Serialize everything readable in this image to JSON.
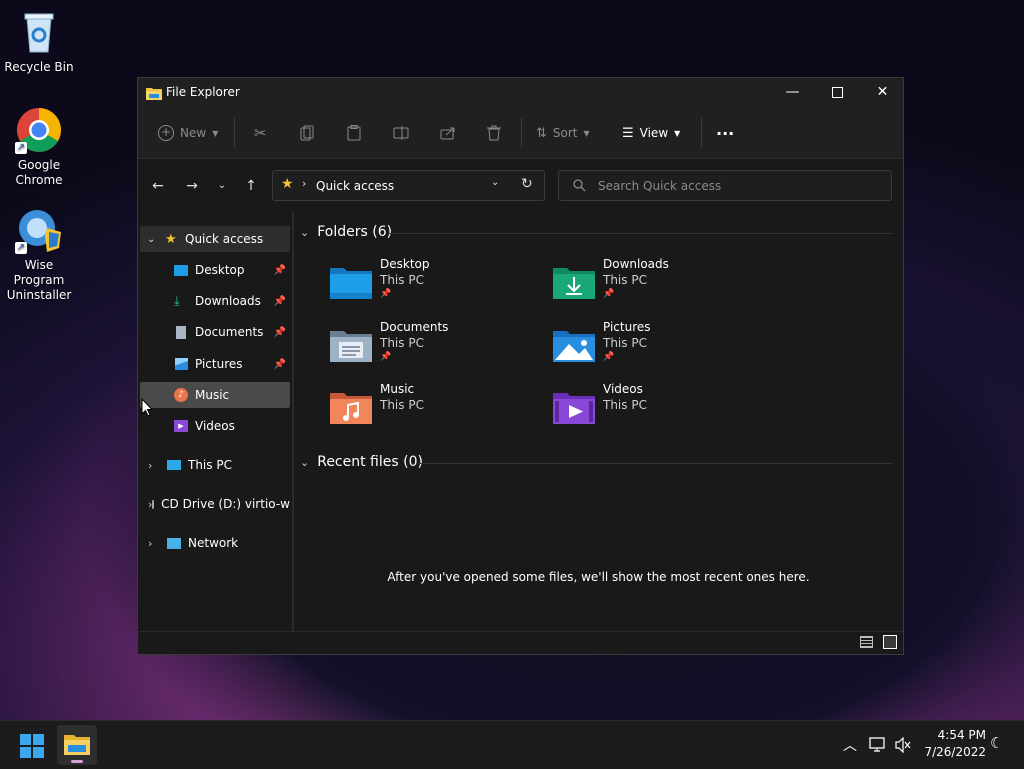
{
  "desktop": {
    "icons": [
      {
        "label": "Recycle Bin"
      },
      {
        "label": "Google\nChrome",
        "line1": "Google",
        "line2": "Chrome"
      },
      {
        "label": "Wise Program Uninstaller",
        "line1": "Wise Program",
        "line2": "Uninstaller"
      }
    ]
  },
  "window": {
    "title": "File Explorer",
    "toolbar": {
      "new_label": "New",
      "sort_label": "Sort",
      "view_label": "View",
      "more_label": "···"
    },
    "address": {
      "path": "Quick access"
    },
    "search": {
      "placeholder": "Search Quick access"
    },
    "sidebar": {
      "quick_access": "Quick access",
      "items": [
        {
          "label": "Desktop",
          "pinned": true
        },
        {
          "label": "Downloads",
          "pinned": true
        },
        {
          "label": "Documents",
          "pinned": true
        },
        {
          "label": "Pictures",
          "pinned": true
        },
        {
          "label": "Music",
          "pinned": false
        },
        {
          "label": "Videos",
          "pinned": false
        }
      ],
      "this_pc": "This PC",
      "cd_drive": "CD Drive (D:) virtio-w",
      "network": "Network"
    },
    "folders_header": "Folders (6)",
    "folders": [
      {
        "name": "Desktop",
        "location": "This PC",
        "pinned": true,
        "color": "#1e9ee8"
      },
      {
        "name": "Downloads",
        "location": "This PC",
        "pinned": true,
        "color": "#1aa87a"
      },
      {
        "name": "Documents",
        "location": "This PC",
        "pinned": true,
        "color": "#8aa0b8"
      },
      {
        "name": "Pictures",
        "location": "This PC",
        "pinned": true,
        "color": "#2a8ee0"
      },
      {
        "name": "Music",
        "location": "This PC",
        "pinned": false,
        "color": "#e8744a"
      },
      {
        "name": "Videos",
        "location": "This PC",
        "pinned": false,
        "color": "#8a48d8"
      }
    ],
    "recent_header": "Recent files (0)",
    "recent_empty": "After you've opened some files, we'll show the most recent ones here."
  },
  "taskbar": {
    "time": "4:54 PM",
    "date": "7/26/2022"
  },
  "colors": {
    "accent": "#0078d4",
    "window_bg": "#191919",
    "chrome_bg": "#202020"
  }
}
